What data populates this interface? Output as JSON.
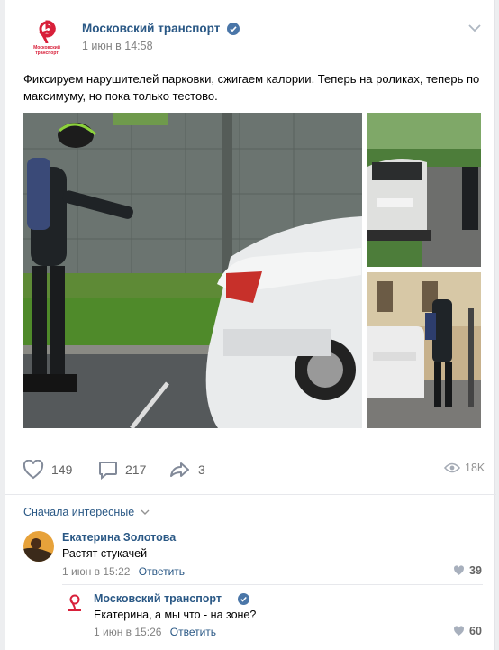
{
  "post": {
    "author": "Московский транспорт",
    "date": "1 июн в 14:58",
    "logo_text_line1": "Московский",
    "logo_text_line2": "транспорт",
    "text": "Фиксируем нарушителей парковки, сжигаем калории. Теперь на роликах, теперь по максимуму, но пока только тестово.",
    "likes": "149",
    "comments": "217",
    "shares": "3",
    "views": "18K"
  },
  "comments": {
    "sort_label": "Сначала интересные",
    "items": [
      {
        "author": "Екатерина Золотова",
        "text": "Растят стукачей",
        "date": "1 июн в 15:22",
        "reply_label": "Ответить",
        "likes": "39"
      },
      {
        "author": "Московский транспорт",
        "text": "Екатерина, а мы что - на зоне?",
        "date": "1 июн в 15:26",
        "reply_label": "Ответить",
        "likes": "60"
      }
    ]
  },
  "colors": {
    "brand_red": "#d8203a",
    "link_blue": "#2a5885",
    "verified_blue": "#4a76a8",
    "muted": "#828282"
  },
  "icons": [
    "metro-logo",
    "verified-icon",
    "chevron-down-icon",
    "heart-icon",
    "comment-icon",
    "share-icon",
    "eye-icon"
  ]
}
